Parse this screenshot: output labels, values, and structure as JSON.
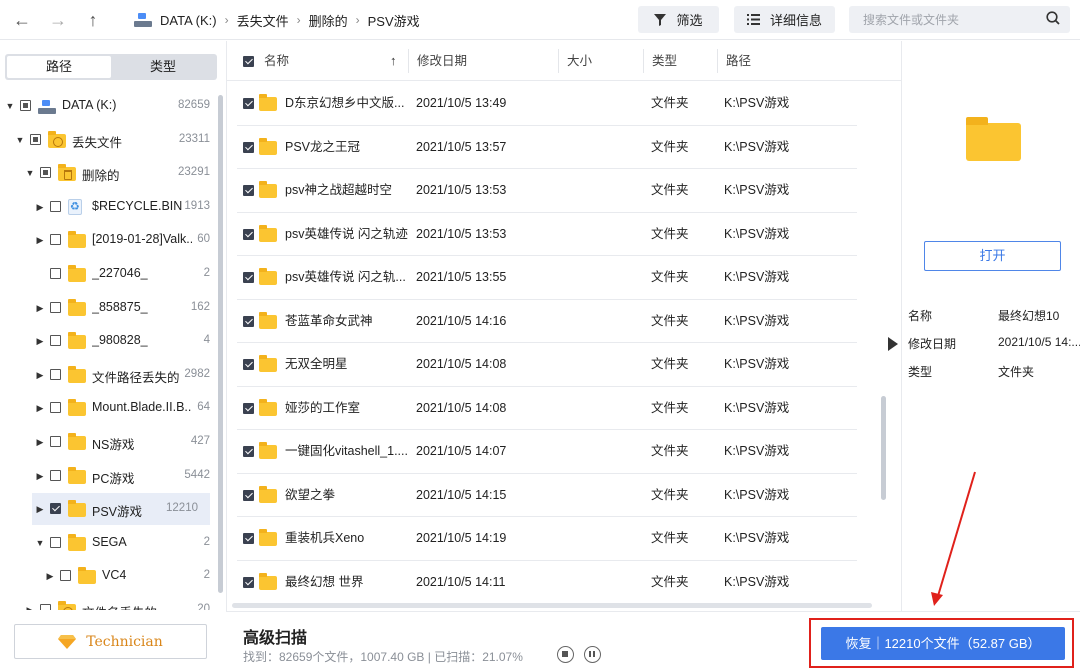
{
  "toolbar": {
    "back_label": "←",
    "forward_label": "→",
    "up_label": "↑",
    "breadcrumb": [
      "DATA (K:)",
      "丢失文件",
      "删除的",
      "PSV游戏"
    ],
    "filter_label": "筛选",
    "details_label": "详细信息",
    "search_placeholder": "搜索文件或文件夹"
  },
  "sidebar": {
    "tabs": [
      "路径",
      "类型"
    ],
    "active_tab": "路径",
    "tree": [
      {
        "label": "DATA (K:)",
        "count": "82659",
        "depth": 0,
        "expanded": true,
        "check": "partial",
        "icon": "drive-icon"
      },
      {
        "label": "丢失文件",
        "count": "23311",
        "depth": 1,
        "expanded": true,
        "check": "partial",
        "icon": "lost-folder-icon"
      },
      {
        "label": "删除的",
        "count": "23291",
        "depth": 2,
        "expanded": true,
        "check": "partial",
        "icon": "deleted-folder-icon"
      },
      {
        "label": "$RECYCLE.BIN",
        "count": "1913",
        "depth": 3,
        "expanded": false,
        "check": "none",
        "icon": "recycle-bin-icon"
      },
      {
        "label": "[2019-01-28]Valk...",
        "count": "60",
        "depth": 3,
        "expanded": false,
        "check": "none",
        "icon": "folder-icon"
      },
      {
        "label": "_227046_",
        "count": "2",
        "depth": 3,
        "expanded": null,
        "check": "none",
        "icon": "folder-icon"
      },
      {
        "label": "_858875_",
        "count": "162",
        "depth": 3,
        "expanded": false,
        "check": "none",
        "icon": "folder-icon"
      },
      {
        "label": "_980828_",
        "count": "4",
        "depth": 3,
        "expanded": false,
        "check": "none",
        "icon": "folder-icon"
      },
      {
        "label": "文件路径丢失的",
        "count": "2982",
        "depth": 3,
        "expanded": false,
        "check": "none",
        "icon": "folder-icon"
      },
      {
        "label": "Mount.Blade.II.B...",
        "count": "64",
        "depth": 3,
        "expanded": false,
        "check": "none",
        "icon": "folder-icon"
      },
      {
        "label": "NS游戏",
        "count": "427",
        "depth": 3,
        "expanded": false,
        "check": "none",
        "icon": "folder-icon"
      },
      {
        "label": "PC游戏",
        "count": "5442",
        "depth": 3,
        "expanded": false,
        "check": "none",
        "icon": "folder-icon"
      },
      {
        "label": "PSV游戏",
        "count": "12210",
        "depth": 3,
        "expanded": false,
        "check": "checked",
        "icon": "folder-icon",
        "selected": true
      },
      {
        "label": "SEGA",
        "count": "2",
        "depth": 3,
        "expanded": true,
        "check": "none",
        "icon": "folder-icon"
      },
      {
        "label": "VC4",
        "count": "2",
        "depth": 4,
        "expanded": false,
        "check": "none",
        "icon": "folder-icon"
      },
      {
        "label": "文件名丢失的",
        "count": "20",
        "depth": 2,
        "expanded": false,
        "check": "none",
        "icon": "lost-folder-icon"
      }
    ],
    "technician_label": "Technician"
  },
  "table": {
    "columns": [
      "名称",
      "修改日期",
      "大小",
      "类型",
      "路径"
    ],
    "sort_indicator": "↑",
    "rows": [
      {
        "name": "D东京幻想乡中文版...",
        "date": "2021/10/5 13:49",
        "size": "",
        "type": "文件夹",
        "path": "K:\\PSV游戏"
      },
      {
        "name": "PSV龙之王冠",
        "date": "2021/10/5 13:57",
        "size": "",
        "type": "文件夹",
        "path": "K:\\PSV游戏"
      },
      {
        "name": "psv神之战超越时空",
        "date": "2021/10/5 13:53",
        "size": "",
        "type": "文件夹",
        "path": "K:\\PSV游戏"
      },
      {
        "name": "psv英雄传说 闪之轨迹",
        "date": "2021/10/5 13:53",
        "size": "",
        "type": "文件夹",
        "path": "K:\\PSV游戏"
      },
      {
        "name": "psv英雄传说 闪之轨...",
        "date": "2021/10/5 13:55",
        "size": "",
        "type": "文件夹",
        "path": "K:\\PSV游戏"
      },
      {
        "name": "苍蓝革命女武神",
        "date": "2021/10/5 14:16",
        "size": "",
        "type": "文件夹",
        "path": "K:\\PSV游戏"
      },
      {
        "name": "无双全明星",
        "date": "2021/10/5 14:08",
        "size": "",
        "type": "文件夹",
        "path": "K:\\PSV游戏"
      },
      {
        "name": "娅莎的工作室",
        "date": "2021/10/5 14:08",
        "size": "",
        "type": "文件夹",
        "path": "K:\\PSV游戏"
      },
      {
        "name": "一键固化vitashell_1....",
        "date": "2021/10/5 14:07",
        "size": "",
        "type": "文件夹",
        "path": "K:\\PSV游戏"
      },
      {
        "name": "欲望之拳",
        "date": "2021/10/5 14:15",
        "size": "",
        "type": "文件夹",
        "path": "K:\\PSV游戏"
      },
      {
        "name": "重装机兵Xeno",
        "date": "2021/10/5 14:19",
        "size": "",
        "type": "文件夹",
        "path": "K:\\PSV游戏"
      },
      {
        "name": "最终幻想 世界",
        "date": "2021/10/5 14:11",
        "size": "",
        "type": "文件夹",
        "path": "K:\\PSV游戏"
      }
    ]
  },
  "details": {
    "open_label": "打开",
    "fields": [
      {
        "key": "名称",
        "value": "最终幻想10"
      },
      {
        "key": "修改日期",
        "value": "2021/10/5 14:..."
      },
      {
        "key": "类型",
        "value": "文件夹"
      }
    ]
  },
  "status": {
    "title": "高级扫描",
    "summary": "找到：82659个文件，1007.40 GB | 已扫描：21.07%",
    "recover_label": "恢复｜12210个文件（52.87 GB）"
  },
  "colors": {
    "accent": "#3b78e7",
    "annotation": "#e0211b",
    "folder": "#fbc531"
  }
}
